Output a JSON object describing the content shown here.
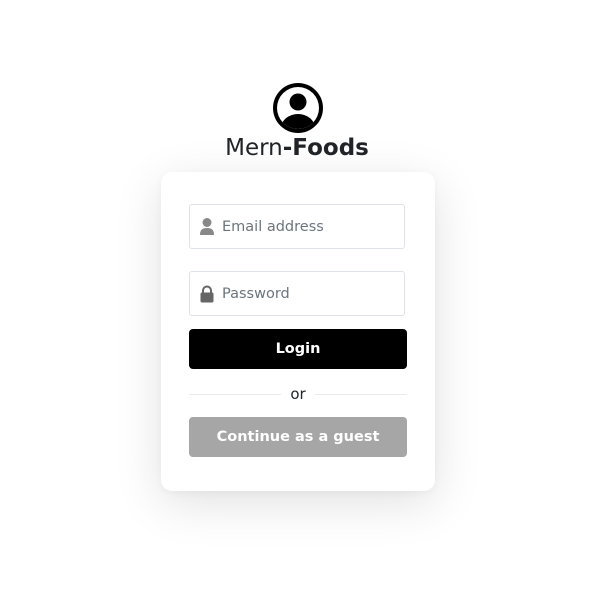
{
  "brand": {
    "name_part1": "Mern",
    "name_part2": "-Foods",
    "logo_icon": "user-circle-icon"
  },
  "login_form": {
    "email_placeholder": "Email address",
    "email_value": "",
    "email_icon": "user-icon",
    "password_placeholder": "Password",
    "password_value": "",
    "password_icon": "lock-icon",
    "login_label": "Login",
    "divider_text": "or",
    "guest_label": "Continue as a guest"
  },
  "colors": {
    "login_button": "#000000",
    "guest_button": "#a6a6a6",
    "text": "#212529",
    "icon": "#6c757d"
  }
}
